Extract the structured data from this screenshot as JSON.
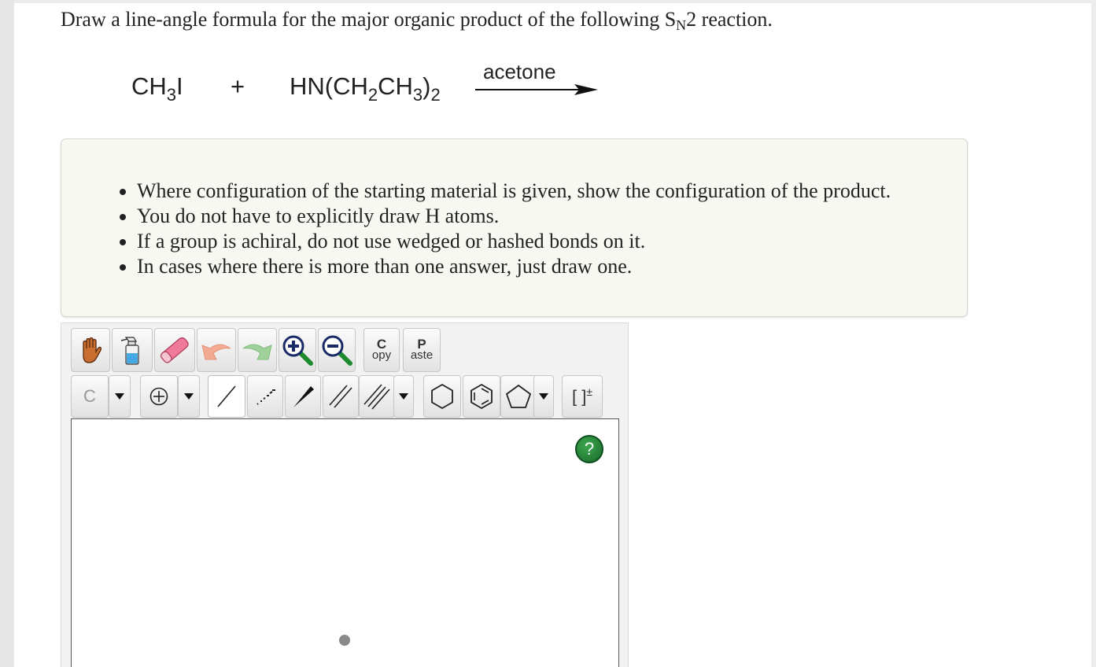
{
  "question": {
    "prefix": "Draw a line-angle formula for the major organic product of the following S",
    "subscript": "N",
    "suffix": "2 reaction."
  },
  "reaction": {
    "reactant1": {
      "main": "CH",
      "sub": "3",
      "tail": "I"
    },
    "plus": "+",
    "reactant2": {
      "a": "HN(CH",
      "sub1": "2",
      "b": "CH",
      "sub2": "3",
      "c": ")",
      "sub3": "2"
    },
    "condition": "acetone"
  },
  "instructions": [
    "Where configuration of the starting material is given, show the configuration of the product.",
    "You do not have to explicitly draw H atoms.",
    "If a group is achiral, do not use wedged or hashed bonds on it.",
    "In cases where there is more than one answer, just draw one."
  ],
  "toolbar": {
    "copy": {
      "first": "C",
      "rest": "opy"
    },
    "paste": {
      "first": "P",
      "rest": "aste"
    },
    "atom_label": "C",
    "charge_symbol": "⊕",
    "bracket_label": "[ ]",
    "bracket_sup": "±"
  },
  "canvas": {
    "help_label": "?"
  },
  "colors": {
    "info_bg": "#f8f8f3",
    "editor_bg": "#f2f2f2",
    "help_green": "#1f7a33"
  }
}
